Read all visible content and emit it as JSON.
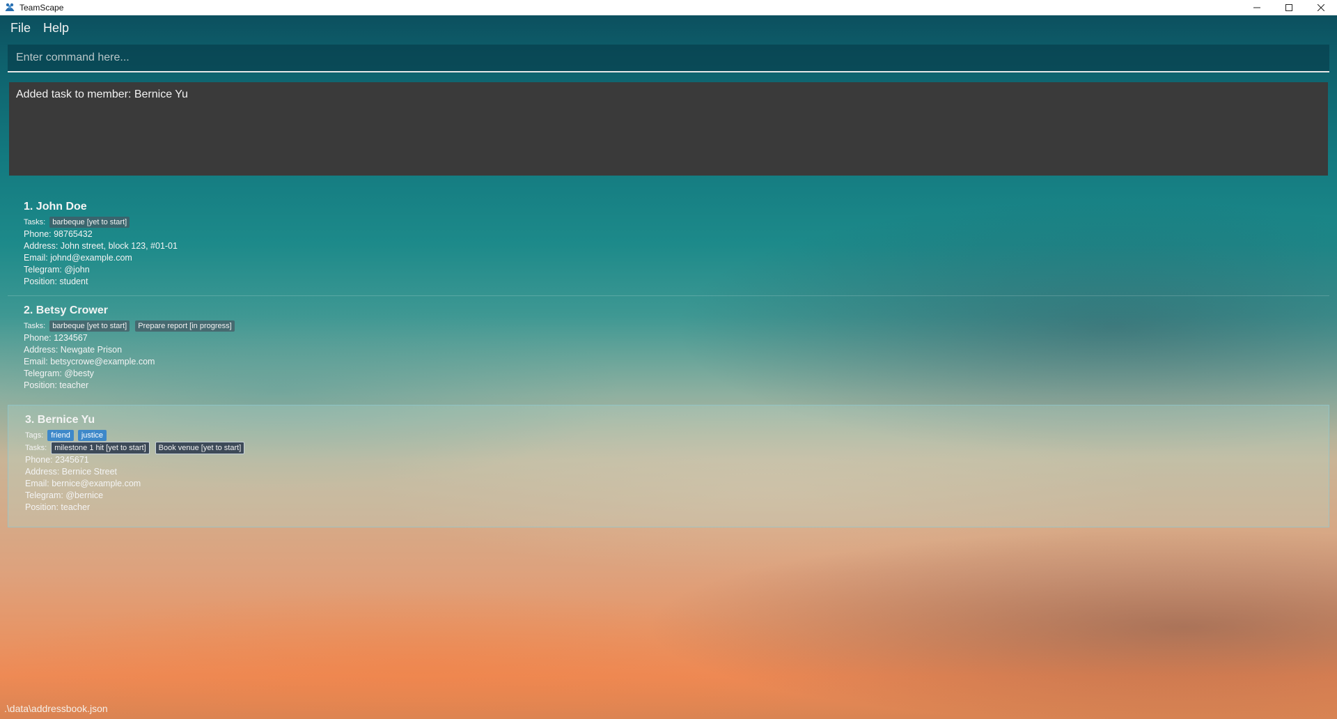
{
  "window": {
    "title": "TeamScape",
    "icons": {
      "app": "team-icon",
      "minimize": "minimize-icon",
      "maximize": "maximize-icon",
      "close": "close-icon"
    }
  },
  "menu": {
    "file": "File",
    "help": "Help"
  },
  "command": {
    "placeholder": "Enter command here...",
    "value": ""
  },
  "result": {
    "message": "Added task to member: Bernice Yu"
  },
  "members": [
    {
      "index_name": "1.  John Doe",
      "tags_label": "",
      "tags": [],
      "tasks_label": "Tasks:",
      "tasks": [
        "barbeque [yet to start]"
      ],
      "phone": "Phone: 98765432",
      "address": "Address: John street, block 123, #01-01",
      "email": "Email: johnd@example.com",
      "telegram": "Telegram: @john",
      "position": "Position: student"
    },
    {
      "index_name": "2.  Betsy Crower",
      "tags_label": "",
      "tags": [],
      "tasks_label": "Tasks:",
      "tasks": [
        "barbeque [yet to start]",
        "Prepare report [in progress]"
      ],
      "phone": "Phone: 1234567",
      "address": "Address: Newgate Prison",
      "email": "Email: betsycrowe@example.com",
      "telegram": "Telegram: @besty",
      "position": "Position: teacher"
    },
    {
      "index_name": "3.  Bernice Yu",
      "tags_label": "Tags:",
      "tags": [
        "friend",
        "justice"
      ],
      "tasks_label": "Tasks:",
      "tasks": [
        "milestone 1 hit [yet to start]",
        "Book venue [yet to start]"
      ],
      "phone": "Phone: 2345671",
      "address": "Address: Bernice Street",
      "email": "Email: bernice@example.com",
      "telegram": "Telegram: @bernice",
      "position": "Position: teacher",
      "selected": true
    }
  ],
  "status": {
    "file_path": ".\\data\\addressbook.json"
  },
  "colors": {
    "tag": "#3e88c9",
    "result_bg": "#3a3a3a",
    "task_chip": "#3d4a58"
  }
}
